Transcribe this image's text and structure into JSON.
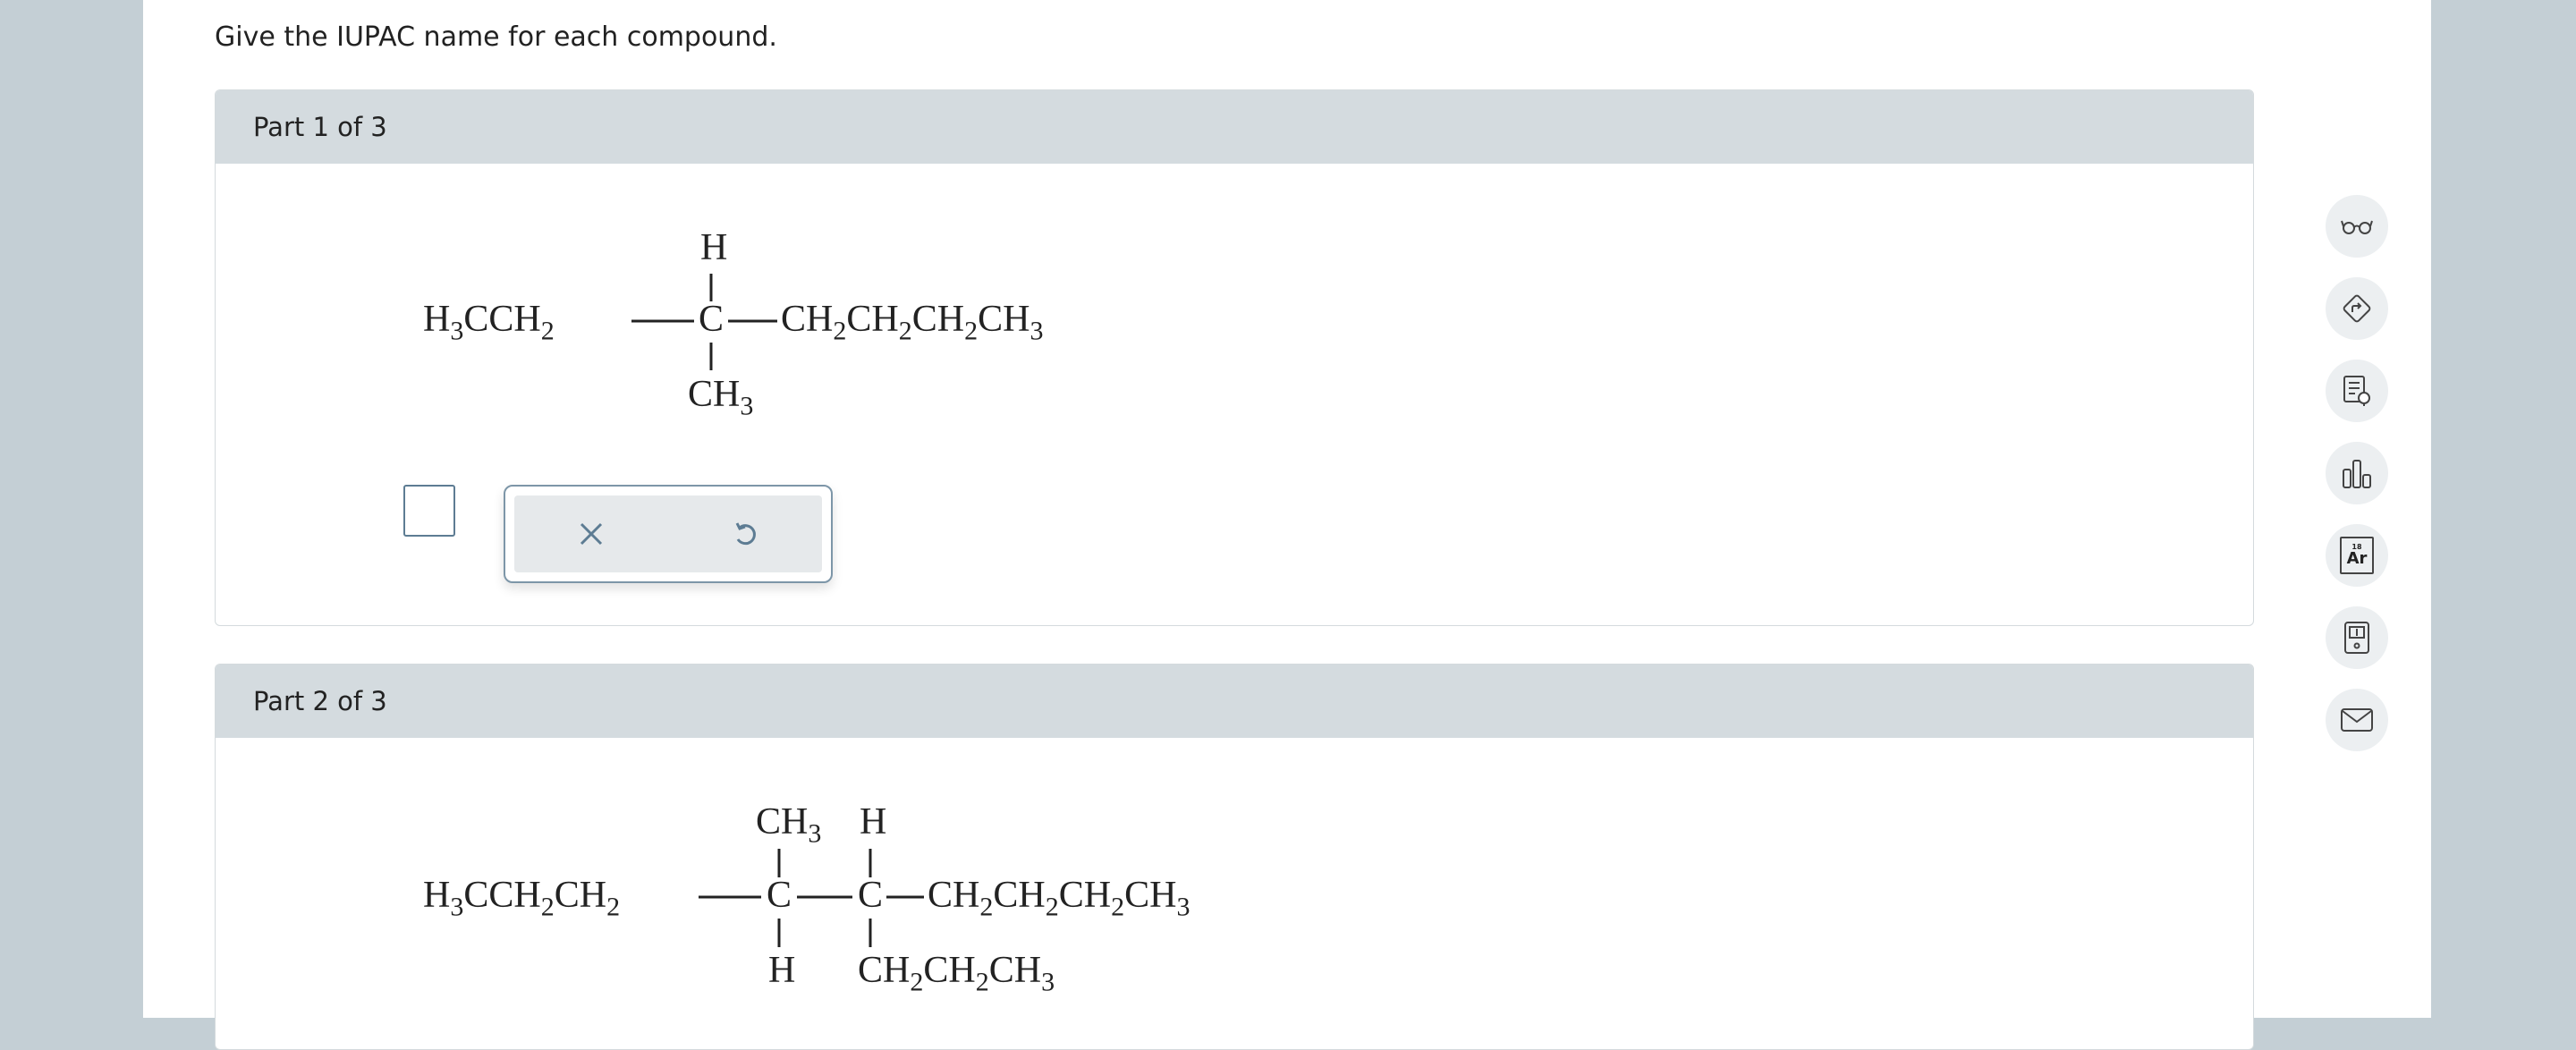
{
  "instructions": "Give the IUPAC name for each compound.",
  "parts": [
    {
      "label": "Part 1 of 3",
      "molecule": {
        "left_group": [
          "H",
          "3",
          "CCH",
          "2"
        ],
        "top": "H",
        "center": "C",
        "bottom": [
          "CH",
          "3"
        ],
        "right_group": [
          "CH",
          "2",
          "CH",
          "2",
          "CH",
          "2",
          "CH",
          "3"
        ]
      },
      "answer": {
        "clear_label": "×",
        "undo_label": "↺"
      }
    },
    {
      "label": "Part 2 of 3",
      "molecule": {
        "left_group": [
          "H",
          "3",
          "CCH",
          "2",
          "CH",
          "2"
        ],
        "c1_top": [
          "CH",
          "3"
        ],
        "c1": "C",
        "c1_bottom": "H",
        "c2_top": "H",
        "c2": "C",
        "c2_bottom": [
          "CH",
          "2",
          "CH",
          "2",
          "CH",
          "3"
        ],
        "right_group": [
          "CH",
          "2",
          "CH",
          "2",
          "CH",
          "2",
          "CH",
          "3"
        ]
      }
    }
  ],
  "side_tools": [
    {
      "name": "explanation-icon"
    },
    {
      "name": "hint-icon"
    },
    {
      "name": "notes-icon"
    },
    {
      "name": "data-icon"
    },
    {
      "name": "periodic-table-icon",
      "number": "18",
      "symbol": "Ar"
    },
    {
      "name": "calculator-icon"
    },
    {
      "name": "message-icon"
    }
  ],
  "colors": {
    "page_background": "#c4cfd5",
    "header_background": "#d4dbdf",
    "checkbox_border": "#5d7c93",
    "tool_background": "#e6e9eb"
  }
}
